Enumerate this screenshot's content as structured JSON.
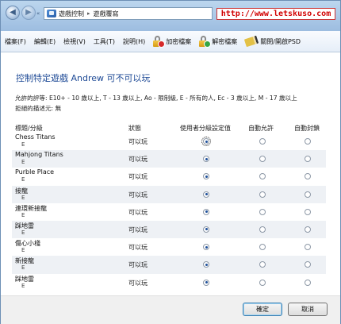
{
  "address": {
    "nav_dropdown": "«",
    "crumbs": [
      "遊戲控制",
      "遊戲覆寫"
    ],
    "separator": "▸"
  },
  "watermark": "http://www.letskuso.com",
  "toolbar": {
    "menus": [
      "檔案(F)",
      "編輯(E)",
      "檢視(V)",
      "工具(T)",
      "說明(H)"
    ],
    "encrypt_label": "加密檔案",
    "decrypt_label": "解密檔案",
    "psd_label": "關閉/開啟PSD"
  },
  "page_title": "控制特定遊戲 Andrew 可不可以玩",
  "allowed_description": "允許的評等: E10+ - 10 歲以上, T - 13 歲以上, Ao - 限制級, E - 所有的人, Ec - 3 歲以上, M - 17 歲以上\n拒絕的描述元: 無",
  "columns": {
    "title": "標題/分級",
    "status": "狀態",
    "use_setting": "使用者分級設定值",
    "always_allow": "自動允許",
    "always_block": "自動封鎖"
  },
  "games": [
    {
      "name": "Chess Titans",
      "rating": "E",
      "status": "可以玩",
      "selected": "use_setting"
    },
    {
      "name": "Mahjong Titans",
      "rating": "E",
      "status": "可以玩",
      "selected": "use_setting"
    },
    {
      "name": "Purble Place",
      "rating": "E",
      "status": "可以玩",
      "selected": "use_setting"
    },
    {
      "name": "接龍",
      "rating": "E",
      "status": "可以玩",
      "selected": "use_setting"
    },
    {
      "name": "連環新接龍",
      "rating": "E",
      "status": "可以玩",
      "selected": "use_setting"
    },
    {
      "name": "踩地雷",
      "rating": "E",
      "status": "可以玩",
      "selected": "use_setting"
    },
    {
      "name": "傷心小棧",
      "rating": "E",
      "status": "可以玩",
      "selected": "use_setting"
    },
    {
      "name": "新接龍",
      "rating": "E",
      "status": "可以玩",
      "selected": "use_setting"
    },
    {
      "name": "踩地雷",
      "rating": "E",
      "status": "可以玩",
      "selected": "use_setting"
    }
  ],
  "buttons": {
    "ok": "確定",
    "cancel": "取消"
  },
  "icons": {
    "back": "back-arrow-icon",
    "forward": "forward-arrow-icon",
    "encrypt": "lock-red-icon",
    "decrypt": "lock-green-icon",
    "psd": "pencil-icon"
  }
}
